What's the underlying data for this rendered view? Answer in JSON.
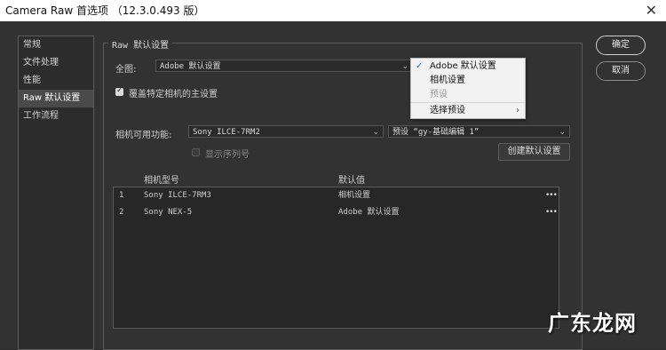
{
  "window": {
    "title": "Camera Raw 首选项 （12.3.0.493 版）",
    "close_glyph": "✕"
  },
  "sidebar": {
    "items": [
      {
        "label": "常规",
        "active": false
      },
      {
        "label": "文件处理",
        "active": false
      },
      {
        "label": "性能",
        "active": false
      },
      {
        "label": "Raw 默认设置",
        "active": true
      },
      {
        "label": "工作流程",
        "active": false
      }
    ]
  },
  "raw_defaults": {
    "group_title": "Raw 默认设置",
    "global_label": "全图:",
    "global_value": "Adobe 默认设置",
    "override_label": "覆盖特定相机的主设置",
    "override_checked": true,
    "camera_label": "相机可用功能:",
    "camera_value": "Sony ILCE-7RM2",
    "preset_value": "预设 “gy-基础编辑 1”",
    "serial_label": "显示序列号",
    "serial_checked": false,
    "create_default_button": "创建默认设置",
    "table": {
      "headers": [
        "相机型号",
        "默认值"
      ],
      "rows": [
        {
          "index": "1",
          "model": "Sony ILCE-7RM3",
          "default": "相机设置",
          "more": "•••"
        },
        {
          "index": "2",
          "model": "Sony NEX-5",
          "default": "Adobe 默认设置",
          "more": "•••"
        }
      ]
    }
  },
  "dropdown_menu": {
    "items": [
      {
        "label": "Adobe 默认设置",
        "checked": true,
        "disabled": false
      },
      {
        "label": "相机设置",
        "checked": false,
        "disabled": false
      },
      {
        "label": "预设",
        "checked": false,
        "disabled": true
      },
      {
        "label": "选择预设",
        "checked": false,
        "disabled": false,
        "submenu": true
      }
    ],
    "check_glyph": "✓",
    "submenu_glyph": "›"
  },
  "buttons": {
    "ok": "确定",
    "cancel": "取消"
  },
  "watermark": "广东龙网",
  "colors": {
    "background": "#323232",
    "menu_bg": "#f2f2f2",
    "check_accent": "#1e74d4"
  }
}
